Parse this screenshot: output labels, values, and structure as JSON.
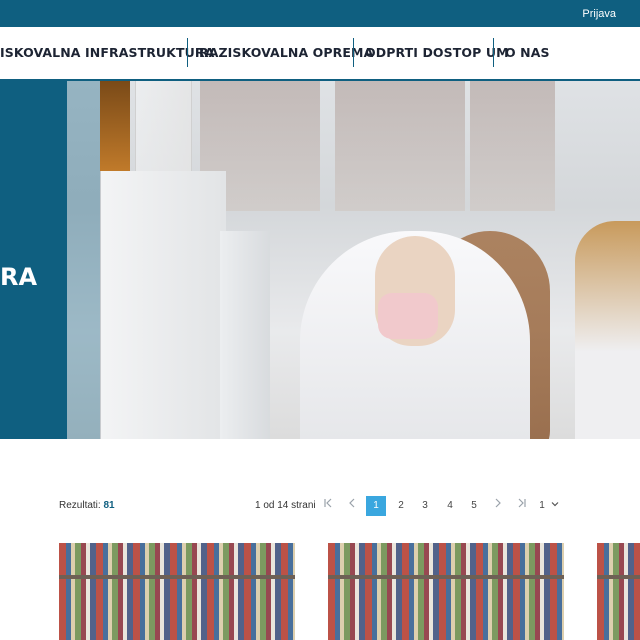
{
  "topbar": {
    "login_label": "Prijava"
  },
  "nav": {
    "items": [
      "ISKOVALNA INFRASTRUKTURA",
      "RAZISKOVALNA OPREMA",
      "ODPRTI DOSTOP UM",
      "O NAS"
    ]
  },
  "hero": {
    "title_fragment": "RA"
  },
  "results": {
    "label": "Rezultati:",
    "count": "81"
  },
  "pagination": {
    "info": "1 od 14 strani",
    "pages": [
      "1",
      "2",
      "3",
      "4",
      "5"
    ],
    "current_page": "1",
    "page_select_value": "1",
    "icons": [
      "first-page-icon",
      "prev-page-icon",
      "next-page-icon",
      "last-page-icon",
      "chevron-down-icon"
    ]
  },
  "colors": {
    "brand": "#0f5f80",
    "accent": "#3aa7df"
  }
}
